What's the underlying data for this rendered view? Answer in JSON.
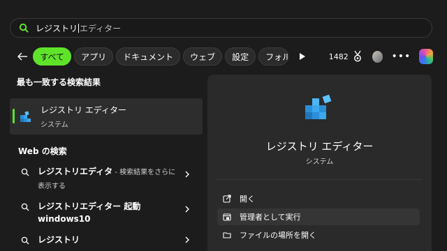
{
  "search": {
    "typed": "レジストリ",
    "suggestion": "エディター"
  },
  "filters": {
    "chips": [
      "すべて",
      "アプリ",
      "ドキュメント",
      "ウェブ",
      "設定",
      "フォル"
    ],
    "points": "1482"
  },
  "left": {
    "best_match_title": "最も一致する検索結果",
    "best_match": {
      "name": "レジストリ エディター",
      "type": "システム"
    },
    "web_title": "Web の検索",
    "web_results": [
      {
        "bold": "レジストリエディタ",
        "rest": " - 検索結果をさらに表示する"
      },
      {
        "bold": "レジストリエディター 起動",
        "line2": "windows10"
      },
      {
        "bold": "レジストリ"
      }
    ]
  },
  "panel": {
    "title": "レジストリ エディター",
    "subtitle": "システム",
    "actions": [
      "開く",
      "管理者として実行",
      "ファイルの場所を開く"
    ]
  },
  "colors": {
    "accent": "#5fe32a",
    "background": "#1c1c1c",
    "panel": "#2a2a2a"
  }
}
